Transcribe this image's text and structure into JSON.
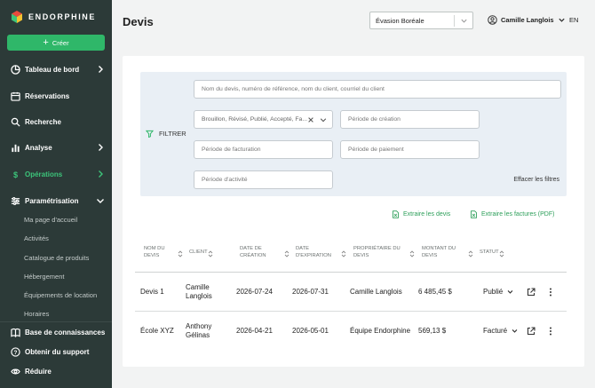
{
  "brand": {
    "name": "ENDORPHINE"
  },
  "sidebar": {
    "create_label": "Créer",
    "items": [
      {
        "label": "Tableau de bord",
        "icon": "pie-chart-icon"
      },
      {
        "label": "Réservations",
        "icon": "calendar-icon"
      },
      {
        "label": "Recherche",
        "icon": "search-icon"
      },
      {
        "label": "Analyse",
        "icon": "bar-chart-icon"
      },
      {
        "label": "Opérations",
        "icon": "dollar-icon"
      },
      {
        "label": "Paramétrisation",
        "icon": "sliders-icon"
      }
    ],
    "sub_items": [
      "Ma page d'accueil",
      "Activités",
      "Catalogue de produits",
      "Hébergement",
      "Équipements de location",
      "Horaires"
    ],
    "bottom_items": [
      {
        "label": "Base de connaissances",
        "icon": "book-icon"
      },
      {
        "label": "Obtenir du support",
        "icon": "help-icon"
      },
      {
        "label": "Réduire",
        "icon": "eye-icon"
      }
    ],
    "active_color": "#3cc47a"
  },
  "header": {
    "title": "Devis",
    "organization": "Évasion Boréale",
    "user_name": "Camille Langlois",
    "language": "EN"
  },
  "filters": {
    "label": "FILTRER",
    "search_placeholder": "Nom du devis, numéro de référence, nom du client, courriel du client",
    "status_value": "Brouillon, Révisé, Publié, Accepté, Fa...",
    "creation_period_placeholder": "Période de création",
    "billing_period_placeholder": "Période de facturation",
    "payment_period_placeholder": "Période de paiement",
    "activity_period_placeholder": "Période d'activité",
    "clear_label": "Effacer les filtres"
  },
  "exports": {
    "quotes_label": "Extraire les devis",
    "invoices_label": "Extraire les factures (PDF)"
  },
  "table": {
    "headers": [
      "NOM DU DEVIS",
      "CLIENT",
      "DATE DE CRÉATION",
      "DATE D'EXPIRATION",
      "PROPRIÉTAIRE DU DEVIS",
      "MONTANT DU DEVIS",
      "STATUT"
    ],
    "rows": [
      {
        "name": "Devis 1",
        "client": "Camille Langlois",
        "created": "2026-07-24",
        "expires": "2026-07-31",
        "owner": "Camille Langlois",
        "amount": "6 485,45 $",
        "status": "Publié"
      },
      {
        "name": "École XYZ",
        "client": "Anthony Gélinas",
        "created": "2026-04-21",
        "expires": "2026-05-01",
        "owner": "Équipe Endorphine",
        "amount": "569,13 $",
        "status": "Facturé"
      }
    ]
  }
}
